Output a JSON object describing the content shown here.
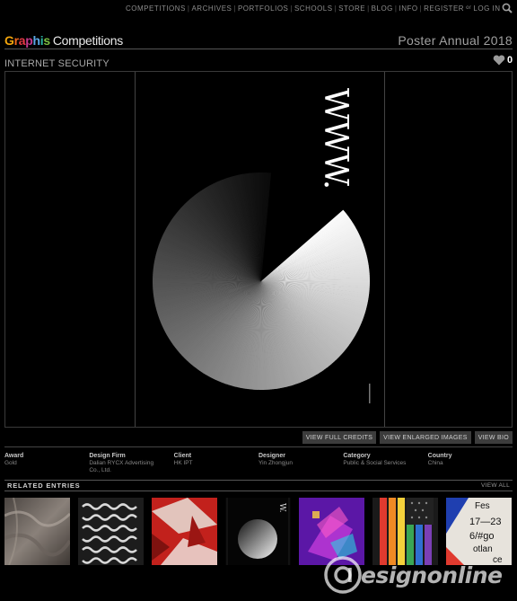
{
  "nav": {
    "items": [
      "COMPETITIONS",
      "ARCHIVES",
      "PORTFOLIOS",
      "SCHOOLS",
      "STORE",
      "BLOG",
      "INFO"
    ],
    "register": "REGISTER",
    "or": "or",
    "login": "LOG IN"
  },
  "brand": {
    "logo_letters": [
      "G",
      "r",
      "a",
      "p",
      "h",
      "i",
      "s"
    ],
    "logo_colors": [
      "#f2a50c",
      "#f26a1b",
      "#e63946",
      "#c2398c",
      "#5aa9e6",
      "#2bb3a0",
      "#7bc043"
    ],
    "section": "Competitions"
  },
  "annual_title": "Poster Annual 2018",
  "entry": {
    "title": "INTERNET SECURITY",
    "likes": "0",
    "poster_text": "WWW."
  },
  "buttons": {
    "credits": "VIEW FULL CREDITS",
    "enlarged": "VIEW ENLARGED IMAGES",
    "bio": "VIEW BIO"
  },
  "details": [
    {
      "label": "Award",
      "value": "Gold"
    },
    {
      "label": "Design Firm",
      "value": "Dalian RYCX Advertising Co., Ltd."
    },
    {
      "label": "Client",
      "value": "HK IPT"
    },
    {
      "label": "Designer",
      "value": "Yin Zhongjun"
    },
    {
      "label": "Category",
      "value": "Public & Social Services"
    },
    {
      "label": "Country",
      "value": "China"
    }
  ],
  "related": {
    "title": "RELATED ENTRIES",
    "view_all": "VIEW ALL",
    "thumb_texts": {
      "last_line1": "Fes",
      "last_line2": "17—23",
      "last_line3": "6/#go",
      "last_line4": "otlan",
      "last_line5": "ce"
    }
  },
  "watermark": {
    "text": "esignonline"
  },
  "colors": {
    "background": "#000000",
    "button_bg": "#3c3c3c",
    "accent_text": "#ffffff"
  }
}
